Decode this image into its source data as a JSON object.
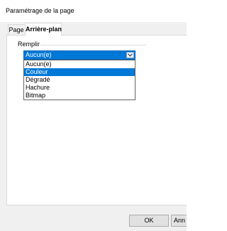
{
  "window": {
    "title": "Paramétrage de la page"
  },
  "tabs": [
    {
      "label": "Page",
      "active": false
    },
    {
      "label": "Arrière-plan",
      "active": true
    }
  ],
  "fill": {
    "group_label": "Remplir",
    "selected_value": "Aucun(e)",
    "options": [
      "Aucun(e)",
      "Couleur",
      "Dégradé",
      "Hachure",
      "Bitmap"
    ],
    "highlighted_index": 1
  },
  "buttons": {
    "ok_label": "OK",
    "cancel_label": "Ann"
  },
  "colors": {
    "accent": "#0078d7",
    "panel_border": "#d9d9d9",
    "button_face": "#e1e1e1"
  },
  "icons": {
    "dropdown": "chevron-down-icon"
  }
}
